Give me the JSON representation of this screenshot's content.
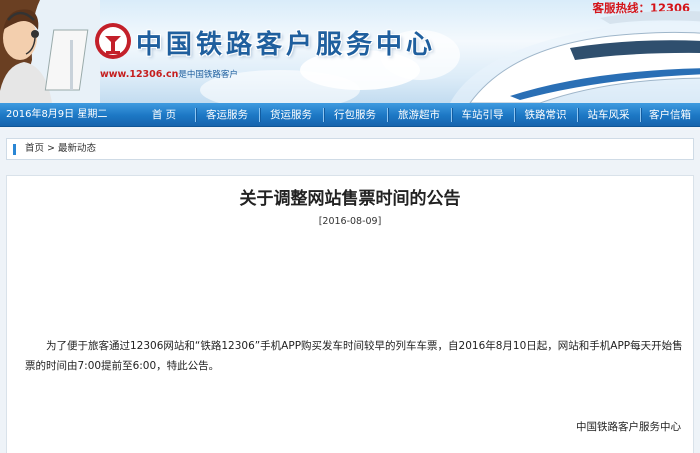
{
  "header": {
    "title": "中国铁路客户服务中心",
    "hotline": "客服热线：12306",
    "url": "www.12306.cn",
    "url_suffix": "是中国铁路客户",
    "icons": {
      "logo": "railway-logo-icon",
      "agent": "customer-service-agent-icon",
      "train": "high-speed-train-icon"
    }
  },
  "nav": {
    "date": "2016年8月9日 星期二",
    "items": [
      {
        "label": "首  页"
      },
      {
        "label": "客运服务"
      },
      {
        "label": "货运服务"
      },
      {
        "label": "行包服务"
      },
      {
        "label": "旅游超市"
      },
      {
        "label": "车站引导"
      },
      {
        "label": "铁路常识"
      },
      {
        "label": "站车风采"
      },
      {
        "label": "客户信箱"
      }
    ]
  },
  "breadcrumb": {
    "home": "首页",
    "separator": " > ",
    "current": "最新动态"
  },
  "article": {
    "title": "关于调整网站售票时间的公告",
    "date": "[2016-08-09]",
    "body": "为了便于旅客通过12306网站和“铁路12306”手机APP购买发车时间较早的列车车票，自2016年8月10日起，网站和手机APP每天开始售票的时间由7:00提前至6:00，特此公告。",
    "signature": "中国铁路客户服务中心"
  },
  "colors": {
    "brand_blue": "#1f5f9e",
    "nav_blue": "#1c77c4",
    "hotline_red": "#d4141a",
    "page_bg": "#eef3f8"
  }
}
